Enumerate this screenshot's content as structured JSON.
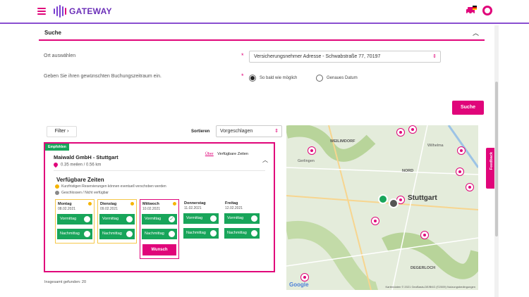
{
  "header": {
    "logo_text": "GATEWAY",
    "brand_color": "#e0057a",
    "accent_color": "#7b3fd0"
  },
  "search_panel": {
    "title": "Suche",
    "location_label": "Ort auswählen",
    "location_value": "Versicherungsnehmer Adresse - Schwabstraße 77, 70197",
    "period_label": "Geben Sie ihren gewünschten Buchungszeitraum ein.",
    "radio_asap": "So bald wie möglich",
    "radio_exact": "Genaues Datum",
    "search_button": "Suche"
  },
  "results": {
    "filter_button": "Filter",
    "sort_label": "Sortieren",
    "sort_value": "Vorgeschlagen",
    "card": {
      "badge": "Empfohlen",
      "company": "Maiwald GmbH - Stuttgart",
      "distance": "0.35 meilen / 0.56 km",
      "link_about": "Über",
      "link_times": "Verfügbare Zeiten",
      "avail_title": "Verfügbare Zeiten",
      "legend_short": "Kurzfristigen Reservierungen können eventuell verschoben werden",
      "legend_closed": "Geschlossen / Nicht verfügbar",
      "days": [
        {
          "name": "Montag",
          "date": "08.02.2021",
          "am": "Vormittag",
          "pm": "Nachmittag"
        },
        {
          "name": "Dienstag",
          "date": "09.02.2021",
          "am": "Vormittag",
          "pm": "Nachmittag"
        },
        {
          "name": "Mittwoch",
          "date": "10.02.2021",
          "am": "Vormittag",
          "pm": "Nachmittag",
          "wish": "Wunsch"
        },
        {
          "name": "Donnerstag",
          "date": "11.02.2021",
          "am": "Vormittag",
          "pm": "Nachmittag"
        },
        {
          "name": "Freitag",
          "date": "12.02.2021",
          "am": "Vormittag",
          "pm": "Nachmittag"
        }
      ]
    },
    "total": "Insgesamt gefunden: 20"
  },
  "map": {
    "labels": {
      "weilimdorf": "WEILIMDORF",
      "stuttgart": "Stuttgart",
      "nord": "NORD",
      "gerlingen": "Gerlingen",
      "wilhelma": "Wilhelma",
      "degerloch": "DEGERLOCH"
    },
    "google": "Google",
    "footer": "Kartendaten © 2021 GeoBasis-DE/BKG (©2009)   Nutzungsbedingungen"
  },
  "feedback_tab": "Feedback"
}
